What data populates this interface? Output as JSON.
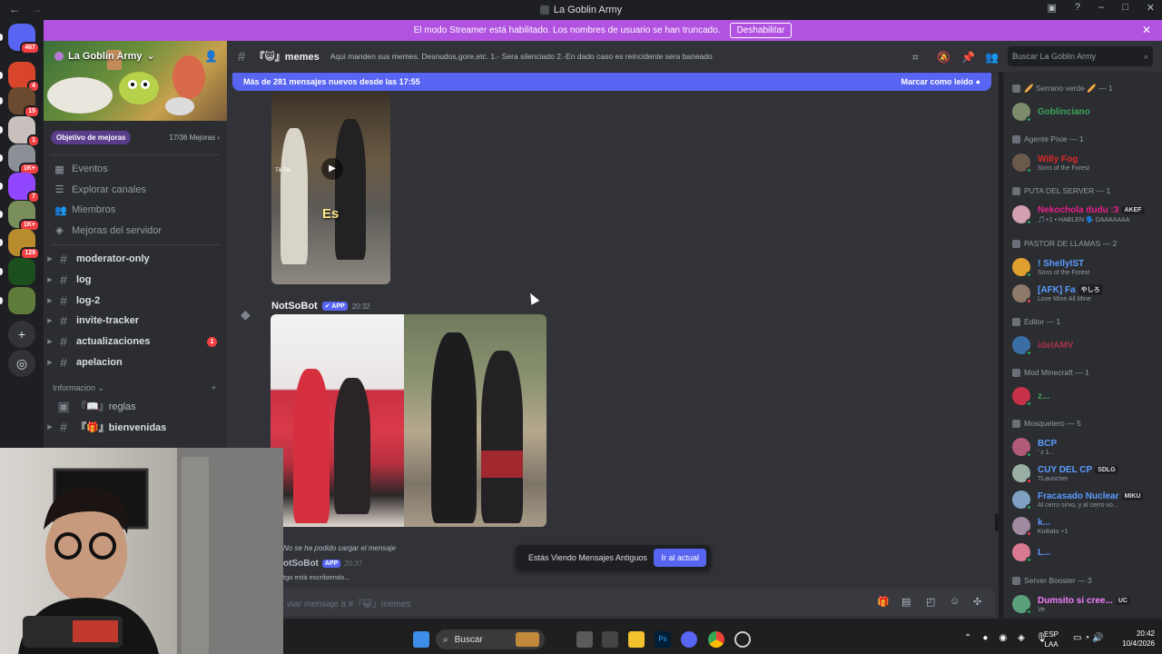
{
  "window": {
    "title": "La Goblin Army",
    "back_icon": "arrow-left-icon",
    "forward_icon": "arrow-right-icon",
    "inbox_icon": "inbox-icon",
    "help_icon": "help-icon",
    "minimize": "–",
    "maximize": "□",
    "close": "✕"
  },
  "guilds": [
    {
      "badge": "467",
      "color": "#5865f2"
    },
    {
      "badge": "4",
      "color": "#d8452b"
    },
    {
      "badge": "15",
      "color": "#6b4a2f"
    },
    {
      "badge": "1",
      "color": "#c8c0bd"
    },
    {
      "badge": "1K+",
      "color": "#8d8f97"
    },
    {
      "badge": "7",
      "color": "#9146ff"
    },
    {
      "badge": "1K+",
      "color": "#7a8e5b"
    },
    {
      "badge": "129",
      "color": "#b88b2c"
    },
    {
      "badge": "",
      "color": "#1b4f1e"
    },
    {
      "badge": "",
      "color": "#5f7b3a"
    }
  ],
  "guild_actions": {
    "add": "+",
    "discover": "◎"
  },
  "banner": {
    "text": "El modo Streamer está habilitado. Los nombres de usuario se han truncado.",
    "button": "Deshabilitar",
    "close": "✕"
  },
  "sidebar": {
    "server_name": "La Goblin Army",
    "boost_goal": "Objetivo de mejoras",
    "boost_count": "17/36 Mejoras",
    "nav": [
      {
        "label": "Eventos",
        "icon": "calendar-icon"
      },
      {
        "label": "Explorar canales",
        "icon": "list-icon"
      },
      {
        "label": "Miembros",
        "icon": "members-icon"
      },
      {
        "label": "Mejoras del servidor",
        "icon": "boost-icon"
      }
    ],
    "channels": [
      {
        "name": "moderator-only"
      },
      {
        "name": "log"
      },
      {
        "name": "log-2"
      },
      {
        "name": "invite-tracker"
      },
      {
        "name": "actualizaciones",
        "unread": "1"
      },
      {
        "name": "apelacion"
      }
    ],
    "category": "Informacion",
    "info_channels": [
      {
        "name": "『📖』reglas",
        "icon": "rules-icon"
      },
      {
        "name": "『🎁』bienvenidas",
        "icon": "hash-icon"
      }
    ]
  },
  "channel_header": {
    "name": "『😺』memes",
    "topic": "Aqui manden sus memes. Desnudos,gore,etc. 1.- Sera silenciado 2.-En dado caso es reincidente sera baneado",
    "search_placeholder": "Buscar La Goblin Army"
  },
  "chat": {
    "new_messages": "Más de 281 mensajes nuevos desde las 17:55",
    "mark_read": "Marcar como leído",
    "video_caption": "Es",
    "video_watermark": "TikTok",
    "msg_author": "NotSoBot",
    "app_tag": "APP",
    "msg_time": "20:32",
    "failed": "No se ha podido cargar el mensaje",
    "author2": "otSoBot",
    "time2": "20:37",
    "typing": "tgo está escribiendo...",
    "old_notice": "Estás Viendo Mensajes Antiguos",
    "jump_now": "Ir al actual",
    "composer": "viar mensaje a #『😺』memes"
  },
  "members": [
    {
      "role": "🥖 Serrano verde 🥖 — 1",
      "users": [
        {
          "name": "Goblinciano",
          "color": "#3ba55c",
          "sub": "",
          "tag": ""
        }
      ]
    },
    {
      "role": "Agente Pixie — 1",
      "users": [
        {
          "name": "Willy Fog",
          "color": "#e02828",
          "sub": "Sons of the Forest",
          "tag": ""
        }
      ]
    },
    {
      "role": "PUTA DEL SERVER — 1",
      "users": [
        {
          "name": "Nekochola dudu :3",
          "color": "#e91e8c",
          "sub": "🎵+1 • HABLEN 🗣️ DAAAAAAA",
          "tag": "AKEF"
        }
      ]
    },
    {
      "role": "PASTOR DE LLAMAS — 2",
      "users": [
        {
          "name": "! ShellyIST",
          "color": "#5b9cff",
          "sub": "Sons of the Forest",
          "tag": ""
        },
        {
          "name": "[AFK] Fa",
          "color": "#5b9cff",
          "sub": "Love Mine All Mine",
          "tag": "やしろ"
        }
      ]
    },
    {
      "role": "Editor — 1",
      "users": [
        {
          "name": "idelAMV",
          "color": "#a8334a",
          "sub": "",
          "tag": ""
        }
      ]
    },
    {
      "role": "Mod Minecraft — 1",
      "users": [
        {
          "name": "z...",
          "color": "#3ba55c",
          "sub": "",
          "tag": ""
        }
      ]
    },
    {
      "role": "Mosquetero — 5",
      "users": [
        {
          "name": "BCP",
          "color": "#5b9cff",
          "sub": "' z 1...",
          "tag": ""
        },
        {
          "name": "CUY DEL CP",
          "color": "#5b9cff",
          "sub": "TLauncher",
          "tag": "SDLG"
        },
        {
          "name": "Fracasado Nuclear",
          "color": "#5b9cff",
          "sub": "Al cerro sirvo, y al cerro vo...",
          "tag": "MIKU"
        },
        {
          "name": "k...",
          "color": "#5b9cff",
          "sub": "Koikatu +1",
          "tag": ""
        },
        {
          "name": "L...",
          "color": "#5b9cff",
          "sub": "",
          "tag": ""
        }
      ]
    },
    {
      "role": "Server Booster — 3",
      "users": [
        {
          "name": "Dumsito si cree...",
          "color": "#f47fff",
          "sub": "Ve",
          "tag": "UC"
        }
      ]
    }
  ],
  "taskbar": {
    "search": "Buscar",
    "lang1": "ESP",
    "lang2": "LAA",
    "time": "20:42",
    "date": "10/4/2026"
  },
  "colors": {
    "accent": "#5865f2",
    "banner": "#b152e0",
    "bg": "#313338",
    "sidebar": "#2b2d31"
  }
}
